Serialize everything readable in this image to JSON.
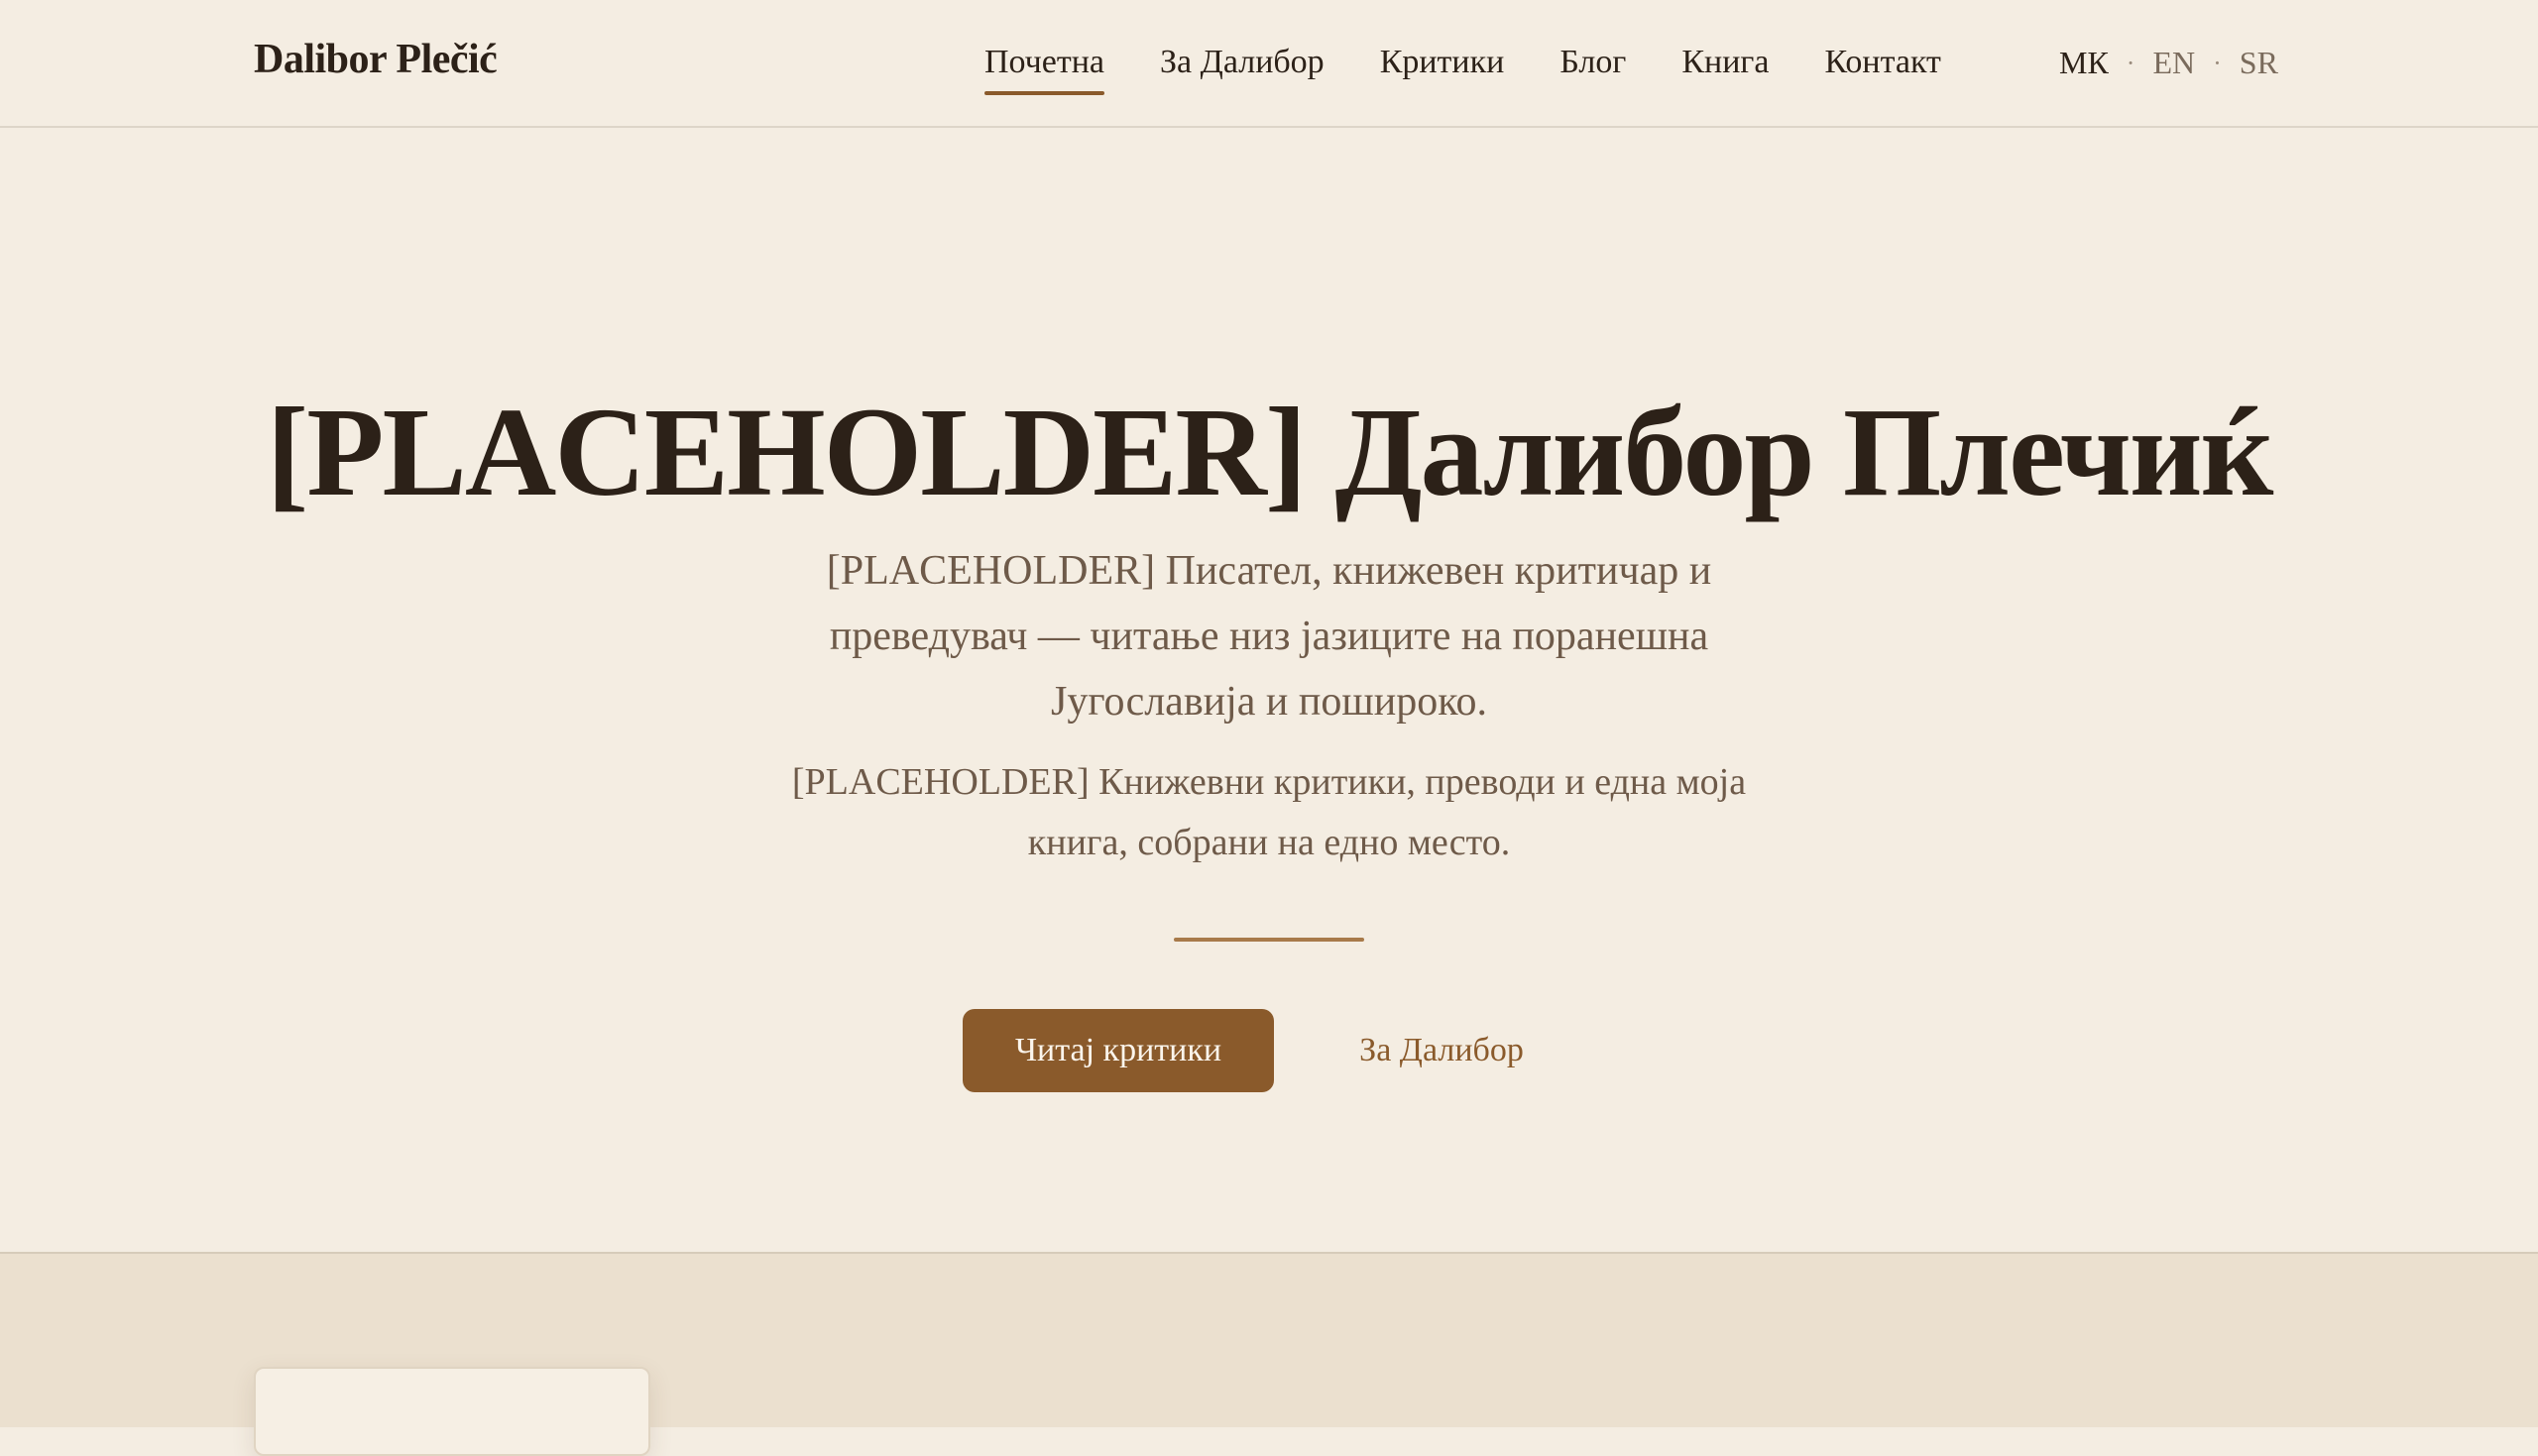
{
  "header": {
    "brand": "Dalibor Plečić",
    "nav": [
      {
        "label": "Почетна",
        "active": true
      },
      {
        "label": "За Далибор",
        "active": false
      },
      {
        "label": "Критики",
        "active": false
      },
      {
        "label": "Блог",
        "active": false
      },
      {
        "label": "Книга",
        "active": false
      },
      {
        "label": "Контакт",
        "active": false
      }
    ],
    "languages": [
      {
        "label": "МК",
        "active": true
      },
      {
        "label": "EN",
        "active": false
      },
      {
        "label": "SR",
        "active": false
      }
    ],
    "lang_separator": "·"
  },
  "hero": {
    "title": "[PLACEHOLDER] Далибор Плечиќ",
    "lead": "[PLACEHOLDER] Писател, книжевен критичар и преведувач — читање низ јазиците на поранешна Југославија и пошироко.",
    "sub": "[PLACEHOLDER] Книжевни критики, преводи и една моја книга, собрани на едно место.",
    "primary_button": "Читај критики",
    "secondary_button": "За Далибор"
  },
  "colors": {
    "background": "#f4ede2",
    "accent": "#8a5a2b",
    "text": "#2c2118",
    "muted_text": "#6e5a49",
    "section_background": "#ebe0cf"
  }
}
